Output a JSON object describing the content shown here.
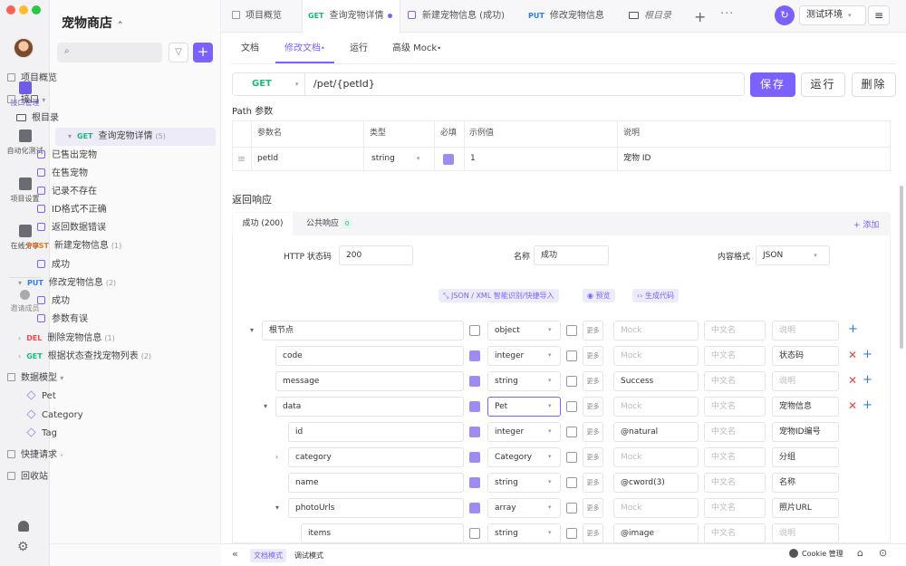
{
  "app": {
    "project_title": "宠物商店"
  },
  "rail": {
    "items": [
      {
        "label": "接口管理",
        "icon": "api-icon"
      },
      {
        "label": "自动化测试",
        "icon": "test-icon"
      },
      {
        "label": "项目设置",
        "icon": "settings-icon"
      },
      {
        "label": "在线分享",
        "icon": "share-icon"
      },
      {
        "label": "邀请成员",
        "icon": "invite-icon"
      }
    ]
  },
  "sidebar": {
    "overview": "项目概览",
    "api_group": "接口",
    "root": "根目录",
    "endpoints": [
      {
        "method": "GET",
        "name": "查询宠物详情",
        "count": "(5)",
        "examples": [
          "已售出宠物",
          "在售宠物",
          "记录不存在",
          "ID格式不正确",
          "返回数据错误"
        ]
      },
      {
        "method": "POST",
        "name": "新建宠物信息",
        "count": "(1)",
        "examples": [
          "成功"
        ]
      },
      {
        "method": "PUT",
        "name": "修改宠物信息",
        "count": "(2)",
        "examples": [
          "成功",
          "参数有误"
        ]
      },
      {
        "method": "DEL",
        "name": "删除宠物信息",
        "count": "(1)",
        "examples": []
      },
      {
        "method": "GET",
        "name": "根据状态查找宠物列表",
        "count": "(2)",
        "examples": []
      }
    ],
    "models_group": "数据模型",
    "models": [
      "Pet",
      "Category",
      "Tag"
    ],
    "quick_request": "快捷请求",
    "trash": "回收站"
  },
  "tabs": [
    {
      "label": "项目概览"
    },
    {
      "method": "GET",
      "label": "查询宠物详情"
    },
    {
      "label": "新建宠物信息 (成功)"
    },
    {
      "method": "PUT",
      "label": "修改宠物信息"
    },
    {
      "label": "根目录"
    }
  ],
  "env": {
    "label": "测试环境"
  },
  "subtabs": [
    "文档",
    "修改文档",
    "运行",
    "高级 Mock"
  ],
  "request": {
    "method": "GET",
    "path": "/pet/{petId}"
  },
  "buttons": {
    "save": "保存",
    "run": "运行",
    "delete": "删除"
  },
  "path_params": {
    "title": "Path 参数",
    "headers": [
      "参数名",
      "类型",
      "必填",
      "示例值",
      "说明"
    ],
    "rows": [
      {
        "name": "petId",
        "type": "string",
        "required": true,
        "example": "1",
        "desc": "宠物 ID"
      }
    ]
  },
  "response": {
    "title": "返回响应",
    "tabs": [
      {
        "label": "成功 (200)"
      },
      {
        "label": "公共响应",
        "badge": "0"
      }
    ],
    "add_label": "添加",
    "status_label": "HTTP 状态码",
    "status_value": "200",
    "name_label": "名称",
    "name_value": "成功",
    "format_label": "内容格式",
    "format_value": "JSON",
    "tools": [
      "JSON / XML 智能识别/快捷导入",
      "预览",
      "生成代码"
    ],
    "placeholders": {
      "mock": "Mock",
      "cn": "中文名",
      "desc": "说明",
      "more": "更多"
    },
    "schema": [
      {
        "name": "根节点",
        "type": "object",
        "required": false,
        "mock": "",
        "desc": "",
        "expand": "down"
      },
      {
        "name": "code",
        "type": "integer",
        "required": true,
        "mock": "",
        "desc": "状态码"
      },
      {
        "name": "message",
        "type": "string",
        "required": true,
        "mock": "Success",
        "desc": ""
      },
      {
        "name": "data",
        "type": "Pet",
        "required": true,
        "mock": "",
        "desc": "宠物信息",
        "expand": "down"
      },
      {
        "name": "id",
        "type": "integer",
        "required": true,
        "mock": "@natural",
        "desc": "宠物ID编号"
      },
      {
        "name": "category",
        "type": "Category",
        "required": true,
        "mock": "",
        "desc": "分组",
        "expand": "right"
      },
      {
        "name": "name",
        "type": "string",
        "required": true,
        "mock": "@cword(3)",
        "desc": "名称"
      },
      {
        "name": "photoUrls",
        "type": "array",
        "required": true,
        "mock": "",
        "desc": "照片URL",
        "expand": "down"
      },
      {
        "name": "items",
        "type": "string",
        "required": false,
        "mock": "@image",
        "desc": ""
      }
    ]
  },
  "bottom": {
    "doc_mode": "文档模式",
    "debug_mode": "调试模式",
    "cookie": "Cookie 管理"
  }
}
